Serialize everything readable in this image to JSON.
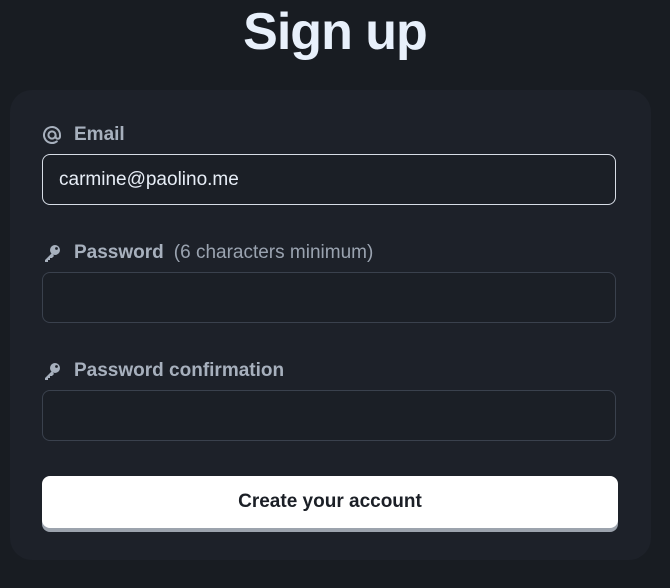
{
  "header": {
    "title": "Sign up"
  },
  "form": {
    "email": {
      "icon": "at-icon",
      "label": "Email",
      "value": "carmine@paolino.me"
    },
    "password": {
      "icon": "key-icon",
      "label": "Password",
      "hint": "(6 characters minimum)",
      "value": ""
    },
    "password_confirmation": {
      "icon": "key-icon",
      "label": "Password confirmation",
      "value": ""
    },
    "submit_label": "Create your account"
  },
  "colors": {
    "background": "#181c22",
    "card": "#1d2129",
    "title": "#e8f0fb",
    "label": "#a7b0bd",
    "button_bg": "#ffffff",
    "button_text": "#1b1f26"
  }
}
